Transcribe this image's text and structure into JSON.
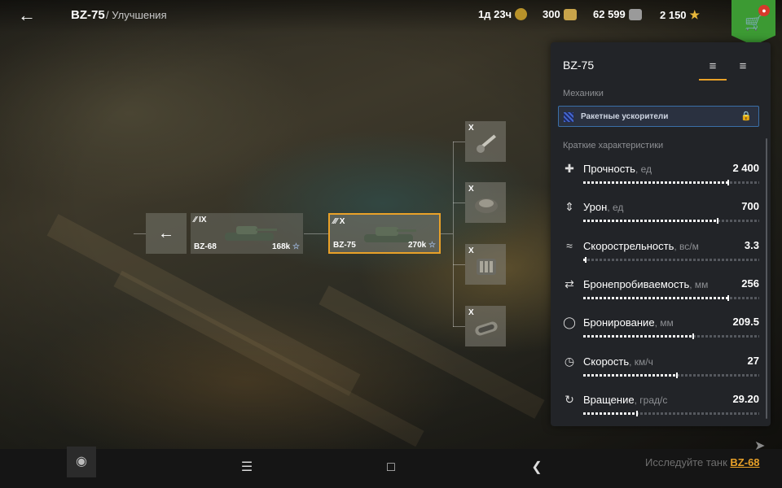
{
  "header": {
    "tank_name": "BZ-75",
    "breadcrumb": "/ Улучшения",
    "premium_time": "1д 23ч",
    "free_xp": "300",
    "credits": "62 599",
    "gold": "2 150"
  },
  "colors": {
    "accent": "#e9a128",
    "shop": "#3c9a33",
    "panel": "#222428"
  },
  "tree": {
    "prev_tank": {
      "tier": "IX",
      "name": "BZ-68",
      "cost": "168k"
    },
    "current_tank": {
      "tier": "X",
      "name": "BZ-75",
      "cost": "270k"
    },
    "modules": [
      {
        "tier": "X",
        "icon": "gun-module-icon"
      },
      {
        "tier": "X",
        "icon": "turret-module-icon"
      },
      {
        "tier": "X",
        "icon": "engine-module-icon"
      },
      {
        "tier": "X",
        "icon": "tracks-module-icon"
      }
    ]
  },
  "panel": {
    "title": "BZ-75",
    "mechanics_label": "Механики",
    "mechanic": "Ракетные ускорители",
    "stats_label": "Краткие характеристики",
    "stats": [
      {
        "name": "Прочность",
        "unit": ", ед",
        "value": "2 400",
        "level": 0.82
      },
      {
        "name": "Урон",
        "unit": ", ед",
        "value": "700",
        "level": 0.76
      },
      {
        "name": "Скорострельность",
        "unit": ", вс/м",
        "value": "3.3",
        "level": 0.01
      },
      {
        "name": "Бронепробиваемость",
        "unit": ", мм",
        "value": "256",
        "level": 0.82
      },
      {
        "name": "Бронирование",
        "unit": ", мм",
        "value": "209.5",
        "level": 0.62
      },
      {
        "name": "Скорость",
        "unit": ", км/ч",
        "value": "27",
        "level": 0.53
      },
      {
        "name": "Вращение",
        "unit": ", град/с",
        "value": "29.20",
        "level": 0.3
      }
    ]
  },
  "footer": {
    "research_text": "Исследуйте танк",
    "research_tank": "BZ-68"
  }
}
